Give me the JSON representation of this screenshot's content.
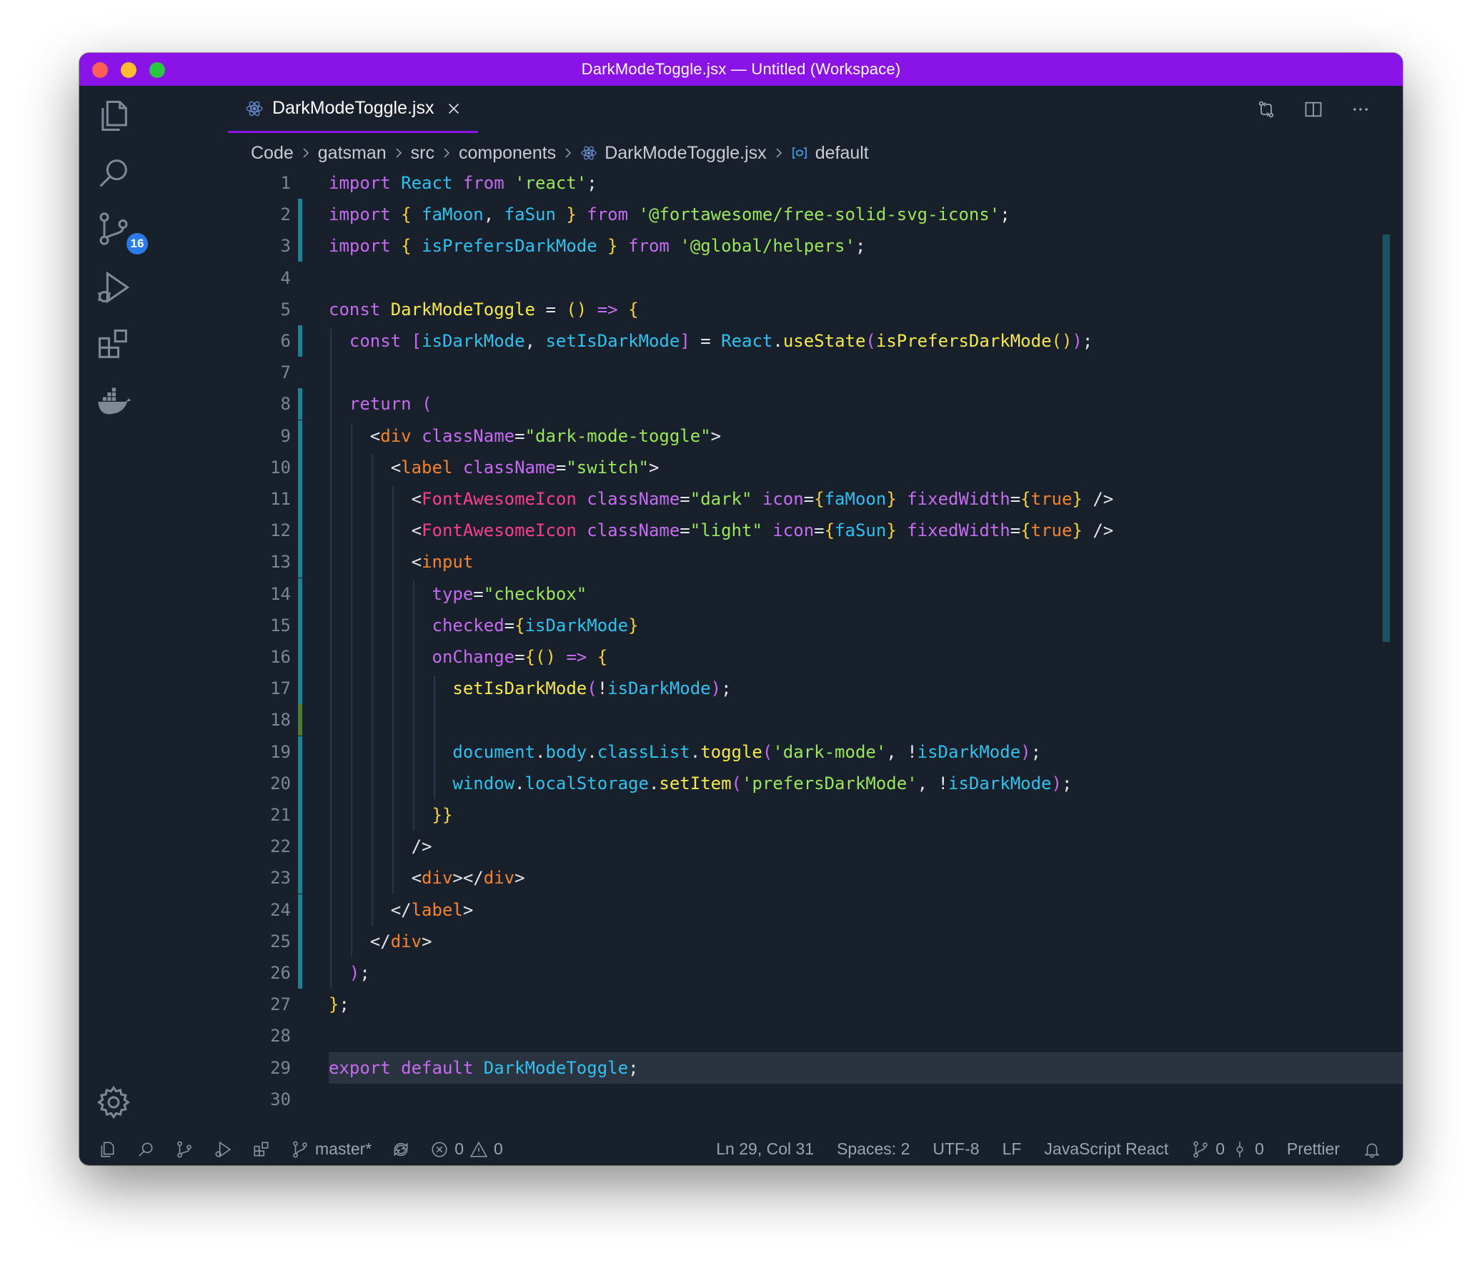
{
  "window": {
    "title": "DarkModeToggle.jsx — Untitled (Workspace)"
  },
  "activity_bar": {
    "items": [
      {
        "icon": "explorer-icon"
      },
      {
        "icon": "search-icon"
      },
      {
        "icon": "source-control-icon",
        "badge": "16"
      },
      {
        "icon": "run-debug-icon"
      },
      {
        "icon": "extensions-icon"
      },
      {
        "icon": "docker-icon"
      }
    ],
    "settings_icon": "gear-icon"
  },
  "tab": {
    "label": "DarkModeToggle.jsx",
    "icon": "react-icon"
  },
  "breadcrumb": {
    "items": [
      "Code",
      "gatsman",
      "src",
      "components",
      "DarkModeToggle.jsx",
      "default"
    ]
  },
  "editor": {
    "active_line": 29,
    "lines": [
      [
        [
          "kw",
          "import"
        ],
        [
          "p",
          " "
        ],
        [
          "id",
          "React"
        ],
        [
          "p",
          " "
        ],
        [
          "kw",
          "from"
        ],
        [
          "p",
          " "
        ],
        [
          "str",
          "'react'"
        ],
        [
          "p",
          ";"
        ]
      ],
      [
        [
          "kw",
          "import"
        ],
        [
          "p",
          " "
        ],
        [
          "br",
          "{"
        ],
        [
          "p",
          " "
        ],
        [
          "id",
          "faMoon"
        ],
        [
          "p",
          ", "
        ],
        [
          "id",
          "faSun"
        ],
        [
          "p",
          " "
        ],
        [
          "br",
          "}"
        ],
        [
          "p",
          " "
        ],
        [
          "kw",
          "from"
        ],
        [
          "p",
          " "
        ],
        [
          "str",
          "'@fortawesome/free-solid-svg-icons'"
        ],
        [
          "p",
          ";"
        ]
      ],
      [
        [
          "kw",
          "import"
        ],
        [
          "p",
          " "
        ],
        [
          "br",
          "{"
        ],
        [
          "p",
          " "
        ],
        [
          "id",
          "isPrefersDarkMode"
        ],
        [
          "p",
          " "
        ],
        [
          "br",
          "}"
        ],
        [
          "p",
          " "
        ],
        [
          "kw",
          "from"
        ],
        [
          "p",
          " "
        ],
        [
          "str",
          "'@global/helpers'"
        ],
        [
          "p",
          ";"
        ]
      ],
      [],
      [
        [
          "kw",
          "const"
        ],
        [
          "p",
          " "
        ],
        [
          "fn",
          "DarkModeToggle"
        ],
        [
          "p",
          " = "
        ],
        [
          "br",
          "()"
        ],
        [
          "p",
          " "
        ],
        [
          "kw",
          "=>"
        ],
        [
          "p",
          " "
        ],
        [
          "br",
          "{"
        ]
      ],
      [
        [
          "p",
          "  "
        ],
        [
          "kw",
          "const"
        ],
        [
          "p",
          " "
        ],
        [
          "kw",
          "["
        ],
        [
          "id",
          "isDarkMode"
        ],
        [
          "p",
          ", "
        ],
        [
          "id",
          "setIsDarkMode"
        ],
        [
          "kw",
          "]"
        ],
        [
          "p",
          " = "
        ],
        [
          "id",
          "React"
        ],
        [
          "p",
          "."
        ],
        [
          "fn",
          "useState"
        ],
        [
          "kw",
          "("
        ],
        [
          "fn",
          "isPrefersDarkMode"
        ],
        [
          "br",
          "()"
        ],
        [
          "kw",
          ")"
        ],
        [
          "p",
          ";"
        ]
      ],
      [],
      [
        [
          "p",
          "  "
        ],
        [
          "kw",
          "return"
        ],
        [
          "p",
          " "
        ],
        [
          "kw",
          "("
        ]
      ],
      [
        [
          "p",
          "    <"
        ],
        [
          "tag",
          "div"
        ],
        [
          "p",
          " "
        ],
        [
          "attr",
          "className"
        ],
        [
          "p",
          "="
        ],
        [
          "str",
          "\"dark-mode-toggle\""
        ],
        [
          "p",
          ">"
        ]
      ],
      [
        [
          "p",
          "      <"
        ],
        [
          "tag",
          "label"
        ],
        [
          "p",
          " "
        ],
        [
          "attr",
          "className"
        ],
        [
          "p",
          "="
        ],
        [
          "str",
          "\"switch\""
        ],
        [
          "p",
          ">"
        ]
      ],
      [
        [
          "p",
          "        <"
        ],
        [
          "comp",
          "FontAwesomeIcon"
        ],
        [
          "p",
          " "
        ],
        [
          "attr",
          "className"
        ],
        [
          "p",
          "="
        ],
        [
          "str",
          "\"dark\""
        ],
        [
          "p",
          " "
        ],
        [
          "attr",
          "icon"
        ],
        [
          "p",
          "="
        ],
        [
          "br",
          "{"
        ],
        [
          "id",
          "faMoon"
        ],
        [
          "br",
          "}"
        ],
        [
          "p",
          " "
        ],
        [
          "attr",
          "fixedWidth"
        ],
        [
          "p",
          "="
        ],
        [
          "br",
          "{"
        ],
        [
          "tag",
          "true"
        ],
        [
          "br",
          "}"
        ],
        [
          "p",
          " />"
        ]
      ],
      [
        [
          "p",
          "        <"
        ],
        [
          "comp",
          "FontAwesomeIcon"
        ],
        [
          "p",
          " "
        ],
        [
          "attr",
          "className"
        ],
        [
          "p",
          "="
        ],
        [
          "str",
          "\"light\""
        ],
        [
          "p",
          " "
        ],
        [
          "attr",
          "icon"
        ],
        [
          "p",
          "="
        ],
        [
          "br",
          "{"
        ],
        [
          "id",
          "faSun"
        ],
        [
          "br",
          "}"
        ],
        [
          "p",
          " "
        ],
        [
          "attr",
          "fixedWidth"
        ],
        [
          "p",
          "="
        ],
        [
          "br",
          "{"
        ],
        [
          "tag",
          "true"
        ],
        [
          "br",
          "}"
        ],
        [
          "p",
          " />"
        ]
      ],
      [
        [
          "p",
          "        <"
        ],
        [
          "tag",
          "input"
        ]
      ],
      [
        [
          "p",
          "          "
        ],
        [
          "attr",
          "type"
        ],
        [
          "p",
          "="
        ],
        [
          "str",
          "\"checkbox\""
        ]
      ],
      [
        [
          "p",
          "          "
        ],
        [
          "attr",
          "checked"
        ],
        [
          "p",
          "="
        ],
        [
          "br",
          "{"
        ],
        [
          "id",
          "isDarkMode"
        ],
        [
          "br",
          "}"
        ]
      ],
      [
        [
          "p",
          "          "
        ],
        [
          "attr",
          "onChange"
        ],
        [
          "p",
          "="
        ],
        [
          "br",
          "{()"
        ],
        [
          "p",
          " "
        ],
        [
          "kw",
          "=>"
        ],
        [
          "p",
          " "
        ],
        [
          "br",
          "{"
        ]
      ],
      [
        [
          "p",
          "            "
        ],
        [
          "fn",
          "setIsDarkMode"
        ],
        [
          "kw",
          "("
        ],
        [
          "p",
          "!"
        ],
        [
          "id",
          "isDarkMode"
        ],
        [
          "kw",
          ")"
        ],
        [
          "p",
          ";"
        ]
      ],
      [],
      [
        [
          "p",
          "            "
        ],
        [
          "id",
          "document"
        ],
        [
          "p",
          "."
        ],
        [
          "id",
          "body"
        ],
        [
          "p",
          "."
        ],
        [
          "id",
          "classList"
        ],
        [
          "p",
          "."
        ],
        [
          "fn",
          "toggle"
        ],
        [
          "kw",
          "("
        ],
        [
          "str",
          "'dark-mode'"
        ],
        [
          "p",
          ", !"
        ],
        [
          "id",
          "isDarkMode"
        ],
        [
          "kw",
          ")"
        ],
        [
          "p",
          ";"
        ]
      ],
      [
        [
          "p",
          "            "
        ],
        [
          "id",
          "window"
        ],
        [
          "p",
          "."
        ],
        [
          "id",
          "localStorage"
        ],
        [
          "p",
          "."
        ],
        [
          "fn",
          "setItem"
        ],
        [
          "kw",
          "("
        ],
        [
          "str",
          "'prefersDarkMode'"
        ],
        [
          "p",
          ", !"
        ],
        [
          "id",
          "isDarkMode"
        ],
        [
          "kw",
          ")"
        ],
        [
          "p",
          ";"
        ]
      ],
      [
        [
          "p",
          "          "
        ],
        [
          "br",
          "}}"
        ]
      ],
      [
        [
          "p",
          "        />"
        ]
      ],
      [
        [
          "p",
          "        <"
        ],
        [
          "tag",
          "div"
        ],
        [
          "p",
          "></"
        ],
        [
          "tag",
          "div"
        ],
        [
          "p",
          ">"
        ]
      ],
      [
        [
          "p",
          "      </"
        ],
        [
          "tag",
          "label"
        ],
        [
          "p",
          ">"
        ]
      ],
      [
        [
          "p",
          "    </"
        ],
        [
          "tag",
          "div"
        ],
        [
          "p",
          ">"
        ]
      ],
      [
        [
          "p",
          "  "
        ],
        [
          "kw",
          ")"
        ],
        [
          "p",
          ";"
        ]
      ],
      [
        [
          "br",
          "}"
        ],
        [
          "p",
          ";"
        ]
      ],
      [],
      [
        [
          "kw",
          "export"
        ],
        [
          "p",
          " "
        ],
        [
          "kw",
          "default"
        ],
        [
          "p",
          " "
        ],
        [
          "id",
          "DarkModeToggle"
        ],
        [
          "p",
          ";"
        ]
      ],
      []
    ]
  },
  "status_bar": {
    "branch": "master*",
    "errors": "0",
    "warnings": "0",
    "cursor": "Ln 29, Col 31",
    "indent": "Spaces: 2",
    "encoding": "UTF-8",
    "eol": "LF",
    "language": "JavaScript React",
    "git_graph_a": "0",
    "git_graph_b": "0",
    "formatter": "Prettier"
  },
  "colors": {
    "title_bar": "#8a14e8",
    "background": "#17202b",
    "keyword": "#c66cf2",
    "identifier": "#2fc1ef",
    "string": "#9ce659",
    "function": "#f6e94d",
    "tag": "#f7842c",
    "component": "#ff3e8e"
  }
}
